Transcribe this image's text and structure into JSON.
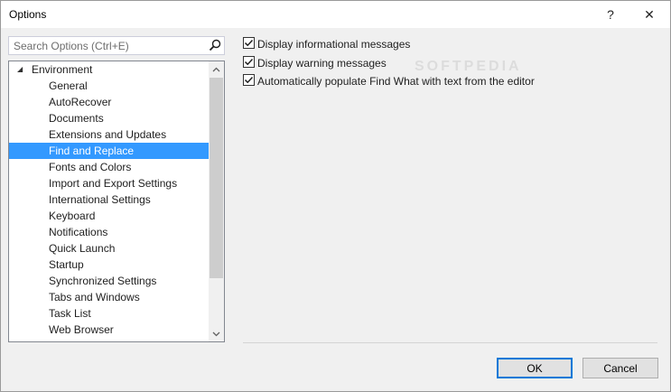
{
  "window": {
    "title": "Options",
    "help_label": "?",
    "close_label": "✕"
  },
  "search": {
    "placeholder": "Search Options (Ctrl+E)",
    "value": ""
  },
  "tree": {
    "root_label": "Environment",
    "items": [
      {
        "label": "General",
        "selected": false
      },
      {
        "label": "AutoRecover",
        "selected": false
      },
      {
        "label": "Documents",
        "selected": false
      },
      {
        "label": "Extensions and Updates",
        "selected": false
      },
      {
        "label": "Find and Replace",
        "selected": true
      },
      {
        "label": "Fonts and Colors",
        "selected": false
      },
      {
        "label": "Import and Export Settings",
        "selected": false
      },
      {
        "label": "International Settings",
        "selected": false
      },
      {
        "label": "Keyboard",
        "selected": false
      },
      {
        "label": "Notifications",
        "selected": false
      },
      {
        "label": "Quick Launch",
        "selected": false
      },
      {
        "label": "Startup",
        "selected": false
      },
      {
        "label": "Synchronized Settings",
        "selected": false
      },
      {
        "label": "Tabs and Windows",
        "selected": false
      },
      {
        "label": "Task List",
        "selected": false
      },
      {
        "label": "Web Browser",
        "selected": false
      }
    ]
  },
  "options": [
    {
      "label": "Display informational messages",
      "checked": true
    },
    {
      "label": "Display warning messages",
      "checked": true
    },
    {
      "label": "Automatically populate Find What with text from the editor",
      "checked": true
    }
  ],
  "watermark": "SOFTPEDIA",
  "buttons": {
    "ok": "OK",
    "cancel": "Cancel"
  },
  "colors": {
    "selection": "#3399ff",
    "default_button_border": "#0078d7"
  }
}
